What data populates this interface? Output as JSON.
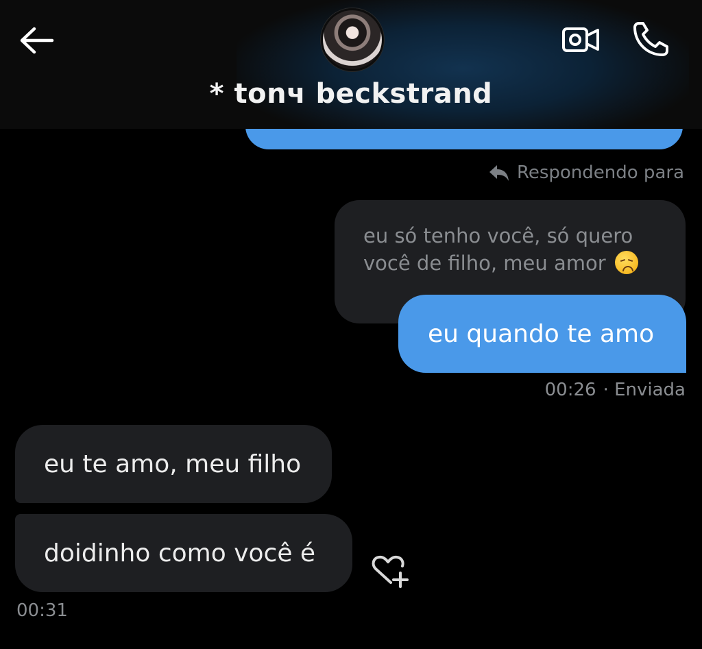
{
  "header": {
    "contact_name": "* tonч beckstrand",
    "icons": {
      "back": "arrow-left-icon",
      "video": "video-camera-icon",
      "phone": "phone-icon"
    }
  },
  "thread": {
    "reply_label": "Respondendo para",
    "quoted_message": {
      "line1": "eu só tenho você, só quero",
      "line2": "você de filho, meu amor"
    },
    "sent_message": {
      "text": "eu quando te amo",
      "time": "00:26",
      "status": "· Enviada"
    },
    "received_messages": [
      {
        "text": "eu te amo, meu filho"
      },
      {
        "text": "doidinho como você é"
      }
    ],
    "received_time": "00:31"
  },
  "colors": {
    "background": "#000000",
    "sent_bubble": "#4a99e9",
    "received_bubble": "#1e1f22",
    "meta_text": "#8a8d91"
  }
}
